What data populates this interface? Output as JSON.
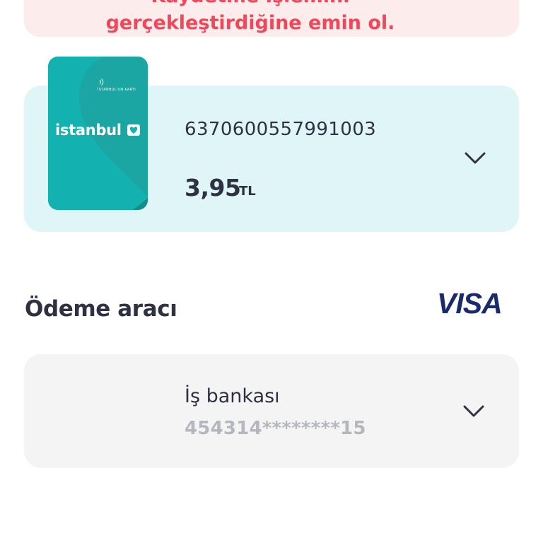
{
  "warning": {
    "line1": "Kaydetme işlemini",
    "line2": "gerçekleştirdiğine emin ol."
  },
  "card": {
    "image_brand": "istanbul",
    "image_small_text": "İSTANBUL'UN KARTI",
    "number": "6370600557991003",
    "balance": "3,95",
    "currency": "TL",
    "expand_icon": "chevron-down-icon"
  },
  "payment": {
    "title": "Ödeme aracı",
    "network_logo": "VISA",
    "bank_name": "İş bankası",
    "masked_card_number": "454314********15",
    "expand_icon": "chevron-down-icon"
  },
  "colors": {
    "warning_text": "#f0475a",
    "warning_bg": "#fdecec",
    "card_panel_bg": "#dff5f7",
    "kart_teal": "#14b1b1",
    "text_dark": "#2d3142",
    "text_muted": "#b4b7be",
    "visa_blue": "#1a2b6d"
  }
}
